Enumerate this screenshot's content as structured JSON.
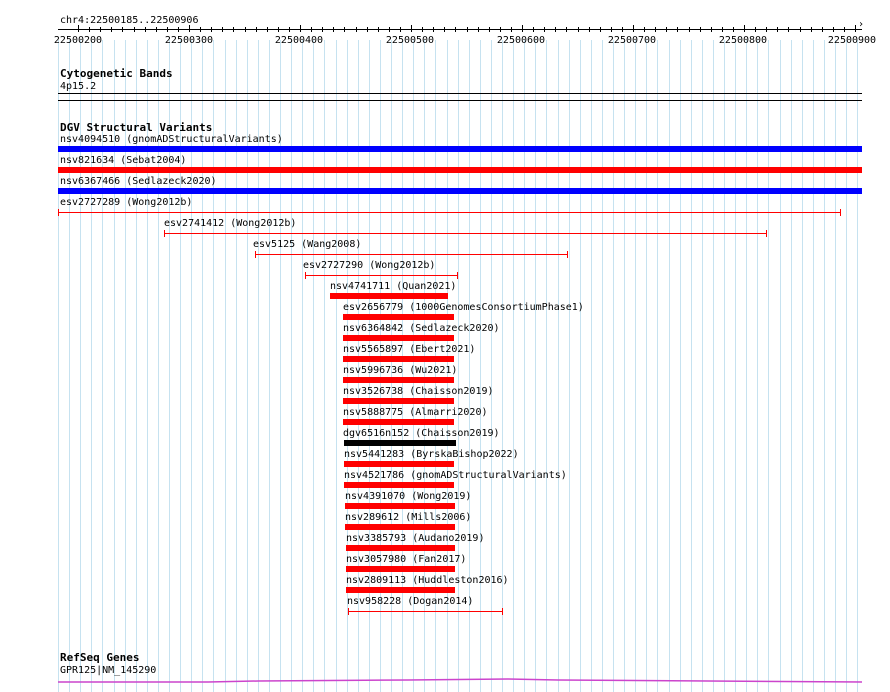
{
  "ruler": {
    "range_label": "chr4:22500185..22500906",
    "ticks": [
      "22500200",
      "22500300",
      "22500400",
      "22500500",
      "22500600",
      "22500700",
      "22500800",
      "22500900"
    ]
  },
  "cytoband": {
    "title": "Cytogenetic Bands",
    "band": "4p15.2"
  },
  "dgv": {
    "title": "DGV Structural Variants",
    "items": [
      {
        "label": "nsv4094510 (gnomADStructuralVariants)",
        "color": "#0000ff",
        "style": "thick"
      },
      {
        "label": "nsv821634 (Sebat2004)",
        "color": "#ff0000",
        "style": "thick"
      },
      {
        "label": "nsv6367466 (Sedlazeck2020)",
        "color": "#0000ff",
        "style": "thick"
      },
      {
        "label": "esv2727289 (Wong2012b)",
        "color": "#ff0000",
        "style": "thin"
      },
      {
        "label": "esv2741412 (Wong2012b)",
        "color": "#ff0000",
        "style": "thin"
      },
      {
        "label": "esv5125 (Wang2008)",
        "color": "#ff0000",
        "style": "thin"
      },
      {
        "label": "esv2727290 (Wong2012b)",
        "color": "#ff0000",
        "style": "thin"
      },
      {
        "label": "nsv4741711 (Quan2021)",
        "color": "#ff0000",
        "style": "thick"
      },
      {
        "label": "esv2656779 (1000GenomesConsortiumPhase1)",
        "color": "#ff0000",
        "style": "thick"
      },
      {
        "label": "nsv6364842 (Sedlazeck2020)",
        "color": "#ff0000",
        "style": "thick"
      },
      {
        "label": "nsv5565897 (Ebert2021)",
        "color": "#ff0000",
        "style": "thick"
      },
      {
        "label": "nsv5996736 (Wu2021)",
        "color": "#ff0000",
        "style": "thick"
      },
      {
        "label": "nsv3526738 (Chaisson2019)",
        "color": "#ff0000",
        "style": "thick"
      },
      {
        "label": "nsv5888775 (Almarri2020)",
        "color": "#ff0000",
        "style": "thick"
      },
      {
        "label": "dgv6516n152 (Chaisson2019)",
        "color": "#000000",
        "style": "thick"
      },
      {
        "label": "nsv5441283 (ByrskaBishop2022)",
        "color": "#ff0000",
        "style": "thick"
      },
      {
        "label": "nsv4521786 (gnomADStructuralVariants)",
        "color": "#ff0000",
        "style": "thick"
      },
      {
        "label": "nsv4391070 (Wong2019)",
        "color": "#ff0000",
        "style": "thick"
      },
      {
        "label": "nsv289612 (Mills2006)",
        "color": "#ff0000",
        "style": "thick"
      },
      {
        "label": "nsv3385793 (Audano2019)",
        "color": "#ff0000",
        "style": "thick"
      },
      {
        "label": "nsv3057980 (Fan2017)",
        "color": "#ff0000",
        "style": "thick"
      },
      {
        "label": "nsv2809113 (Huddleston2016)",
        "color": "#ff0000",
        "style": "thick"
      },
      {
        "label": "nsv958228 (Dogan2014)",
        "color": "#ff0000",
        "style": "thin"
      }
    ]
  },
  "refseq": {
    "title": "RefSeq Genes",
    "gene": "GPR125|NM_145290",
    "color": "#cc44cc"
  }
}
